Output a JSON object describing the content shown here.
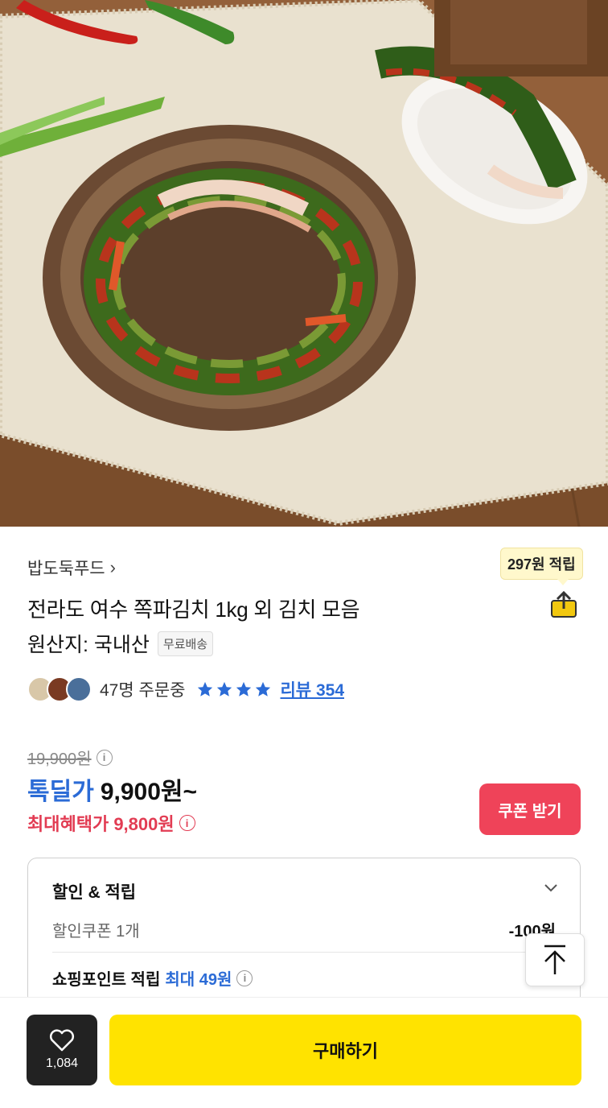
{
  "product": {
    "seller": "밥도둑푸드",
    "title": "전라도 여수 쪽파김치 1kg 외 김치 모음",
    "origin": "원산지: 국내산",
    "free_shipping": "무료배송",
    "points_tooltip": "297원 적립"
  },
  "social": {
    "buyers": "47명 주문중",
    "rating_stars": 4,
    "review_label": "리뷰 354"
  },
  "pricing": {
    "original_price": "19,900원",
    "deal_label": "톡딜가",
    "deal_price": "9,900원~",
    "max_benefit": "최대혜택가 9,800원",
    "coupon_button": "쿠폰 받기"
  },
  "benefits": {
    "title": "할인 & 적립",
    "coupon_label": "할인쿠폰 1개",
    "coupon_amount": "-100원",
    "point_label": "쇼핑포인트 적립",
    "point_max": "최대 49원"
  },
  "bottom": {
    "like_count": "1,084",
    "buy_label": "구매하기"
  },
  "colors": {
    "accent_blue": "#2b6bd6",
    "accent_red": "#e23c53",
    "coupon_bg": "#ef4359",
    "buy_bg": "#ffe300"
  },
  "icons": {
    "share": "share-icon",
    "heart": "heart-icon",
    "top": "arrow-up-icon",
    "chevron": "chevron-down-icon"
  }
}
